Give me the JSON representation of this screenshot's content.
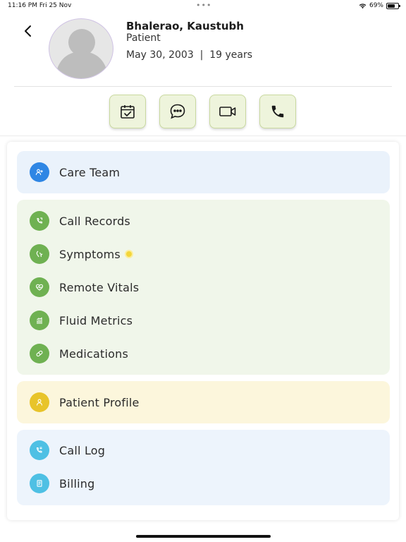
{
  "status_bar": {
    "time": "11:16 PM",
    "date": "Fri 25 Nov",
    "battery": "69%",
    "battery_level": 0.69
  },
  "patient": {
    "name": "Bhalerao, Kaustubh",
    "role": "Patient",
    "dob_line": "May 30, 2003  |  19 years"
  },
  "actions": [
    {
      "icon": "calendar-check-icon"
    },
    {
      "icon": "chat-bubble-icon"
    },
    {
      "icon": "video-camera-icon"
    },
    {
      "icon": "phone-icon"
    }
  ],
  "menu": {
    "care_team": "Care Team",
    "call_records": "Call Records",
    "symptoms": "Symptoms",
    "remote_vitals": "Remote Vitals",
    "fluid_metrics": "Fluid Metrics",
    "medications": "Medications",
    "patient_profile": "Patient Profile",
    "call_log": "Call Log",
    "billing": "Billing"
  },
  "colors": {
    "action_bg": "#eef4dc",
    "blue_group": "#eaf2fb",
    "green_group": "#f0f6ea",
    "yellow_group": "#fcf6dc",
    "icon_blue": "#2f86e4",
    "icon_green": "#6fb152",
    "icon_yellow": "#e8c42a",
    "icon_cyan": "#4ec0e4"
  }
}
